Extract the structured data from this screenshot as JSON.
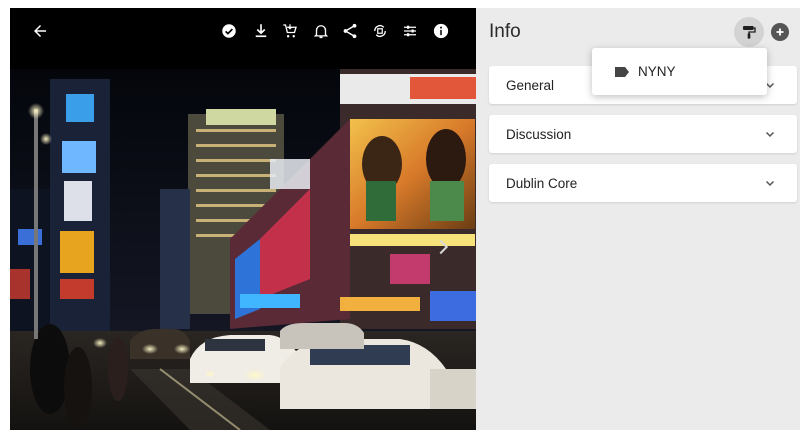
{
  "viewer": {
    "toolbar": {
      "back_icon": "arrow-left-icon",
      "icons": [
        "check-circle-icon",
        "download-icon",
        "cart-icon",
        "bell-icon",
        "share-icon",
        "rotate-crop-icon",
        "adjust-icon",
        "info-icon"
      ]
    },
    "image": {
      "description_only_visual": true,
      "next_icon": "chevron-right-icon"
    }
  },
  "panel": {
    "title": "Info",
    "brush_icon": "paint-roller-icon",
    "add_icon": "add-circle-icon",
    "sections": [
      {
        "label": "General"
      },
      {
        "label": "Discussion"
      },
      {
        "label": "Dublin Core"
      }
    ]
  },
  "popup": {
    "item_label": "NYNY",
    "item_icon": "label-tag-icon"
  },
  "colors": {
    "panel_bg": "#ebebeb",
    "viewer_bg": "#000000"
  }
}
